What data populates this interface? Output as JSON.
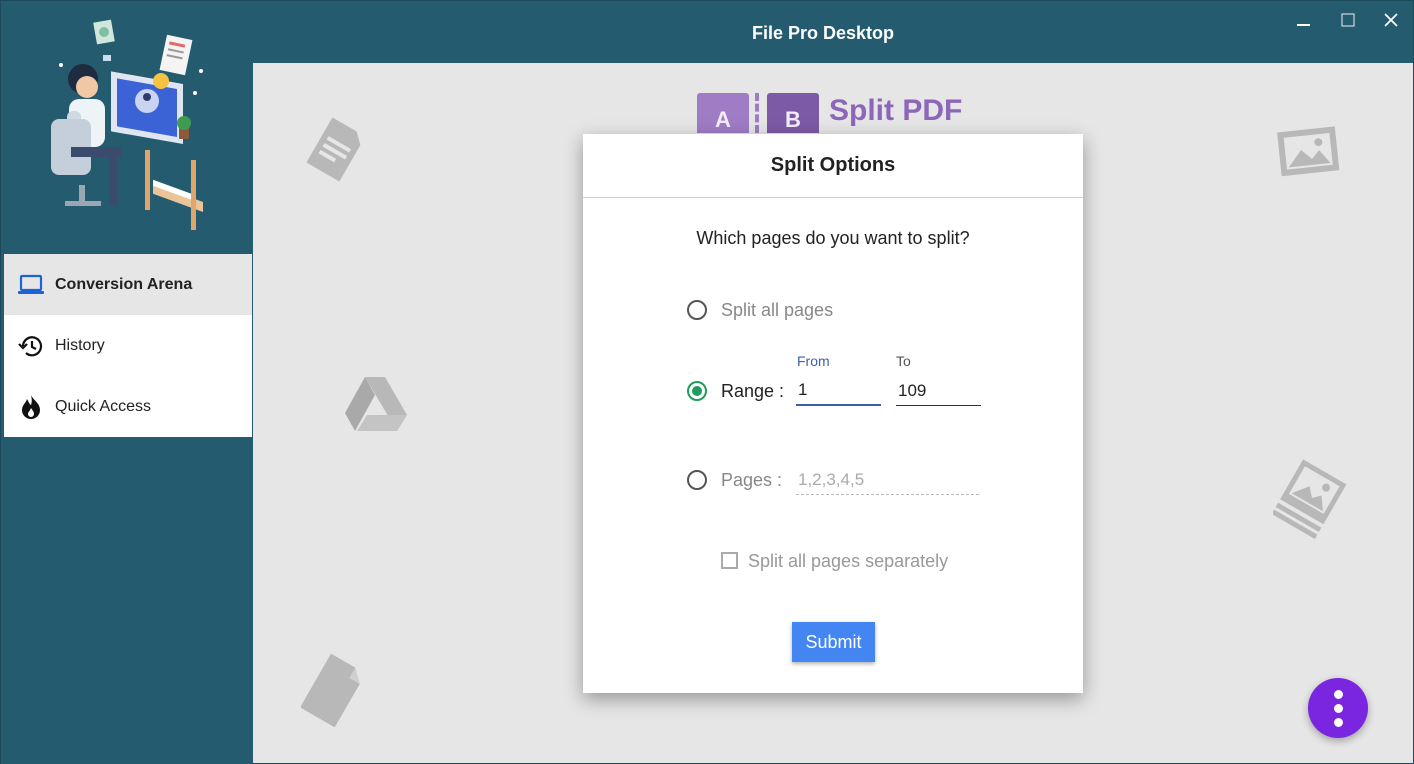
{
  "window": {
    "title": "File Pro Desktop"
  },
  "sidebar": {
    "items": [
      {
        "label": "Conversion Arena",
        "icon": "laptop-icon",
        "active": true
      },
      {
        "label": "History",
        "icon": "history-icon",
        "active": false
      },
      {
        "label": "Quick Access",
        "icon": "flame-icon",
        "active": false
      }
    ]
  },
  "header": {
    "box_a": "A",
    "box_b": "B",
    "title": "Split PDF"
  },
  "dialog": {
    "title": "Split Options",
    "question": "Which pages do you want to split?",
    "option_all": "Split all pages",
    "option_range": "Range :",
    "from_label": "From",
    "to_label": "To",
    "from_value": "1",
    "to_value": "109",
    "option_pages": "Pages :",
    "pages_placeholder": "1,2,3,4,5",
    "separately_label": "Split all pages separately",
    "submit_label": "Submit",
    "selected_option": "range"
  },
  "colors": {
    "titlebar": "#245b6f",
    "accent_green": "#1f9d5a",
    "submit_blue": "#4386f2",
    "fab_purple": "#7a26e0",
    "split_purple": "#8c67b9"
  }
}
